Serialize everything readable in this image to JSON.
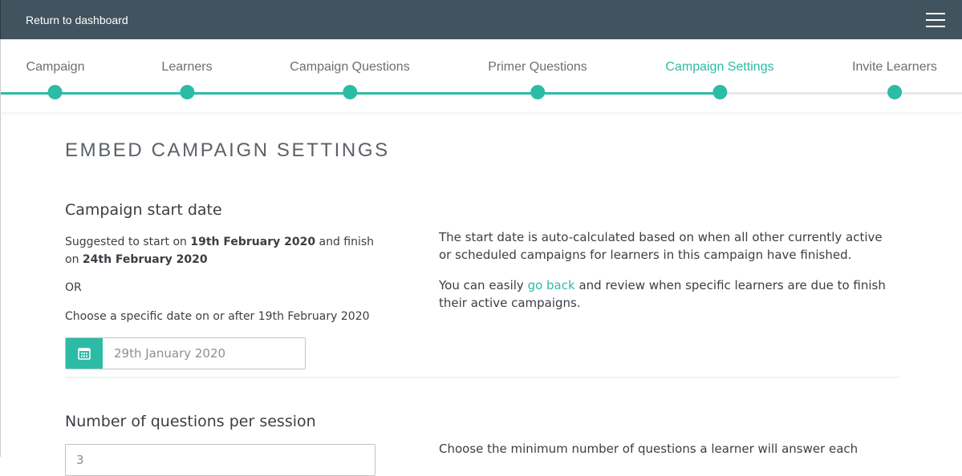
{
  "topbar": {
    "return_label": "Return to dashboard",
    "menu_icon": "hamburger-menu-icon"
  },
  "stepper": {
    "steps": [
      {
        "label": "Campaign",
        "active": false
      },
      {
        "label": "Learners",
        "active": false
      },
      {
        "label": "Campaign Questions",
        "active": false
      },
      {
        "label": "Primer Questions",
        "active": false
      },
      {
        "label": "Campaign Settings",
        "active": true
      },
      {
        "label": "Invite Learners",
        "active": false
      }
    ],
    "active_index": 4
  },
  "page": {
    "title": "EMBED CAMPAIGN SETTINGS"
  },
  "start_date": {
    "heading": "Campaign start date",
    "suggest_prefix": "Suggested to start on ",
    "suggest_start": "19th February 2020",
    "suggest_middle": " and finish on ",
    "suggest_end": "24th February 2020",
    "or_label": "OR",
    "choose_label": "Choose a specific date on or after 19th February 2020",
    "date_value": "29th January 2020",
    "calendar_icon": "calendar-icon",
    "info_paragraph_1": "The start date is auto-calculated based on when all other currently active or scheduled campaigns for learners in this campaign have finished.",
    "info_p2_prefix": "You can easily ",
    "info_p2_link": "go back",
    "info_p2_suffix": " and review when specific learners are due to finish their active campaigns."
  },
  "questions_per_session": {
    "heading": "Number of questions per session",
    "input_value": "3",
    "info_paragraph": "Choose the minimum number of questions a learner will answer each"
  },
  "colors": {
    "topbar_bg": "#41535e",
    "accent": "#2cbca5",
    "text": "#3a3f44",
    "muted_text": "#6a6f74"
  }
}
